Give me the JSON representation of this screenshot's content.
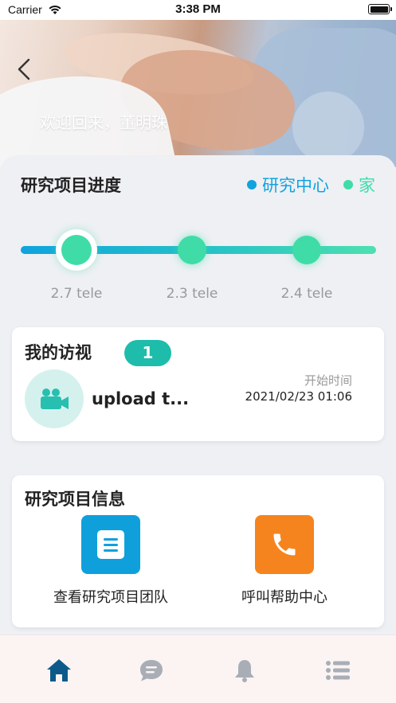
{
  "status_bar": {
    "carrier": "Carrier",
    "time": "3:38 PM"
  },
  "header": {
    "welcome": "欢迎回来，董明珠",
    "back_icon": "chevron-left-icon"
  },
  "progress": {
    "title": "研究项目进度",
    "legend": [
      {
        "label": "研究中心",
        "color": "#10a3de"
      },
      {
        "label": "家",
        "color": "#3fdca8"
      }
    ],
    "nodes": [
      {
        "label": "2.7 tele",
        "active": true
      },
      {
        "label": "2.3 tele",
        "active": false
      },
      {
        "label": "2.4 tele",
        "active": false
      }
    ]
  },
  "visits": {
    "title": "我的访视",
    "count": "1",
    "item": {
      "icon": "video-camera-icon",
      "name": "upload t...",
      "start_label": "开始时间",
      "start_time": "2021/02/23 01:06"
    }
  },
  "project_info": {
    "title": "研究项目信息",
    "actions": [
      {
        "label": "查看研究项目团队",
        "icon": "document-icon",
        "color": "#0fa0dc"
      },
      {
        "label": "呼叫帮助中心",
        "icon": "phone-icon",
        "color": "#f5841f"
      }
    ]
  },
  "tabbar": {
    "tabs": [
      {
        "icon": "home-icon",
        "active": true
      },
      {
        "icon": "chat-bubble-icon",
        "active": false
      },
      {
        "icon": "bell-icon",
        "active": false
      },
      {
        "icon": "list-icon",
        "active": false
      }
    ],
    "active_color": "#0d5a8a",
    "inactive_color": "#a9aeb6"
  }
}
